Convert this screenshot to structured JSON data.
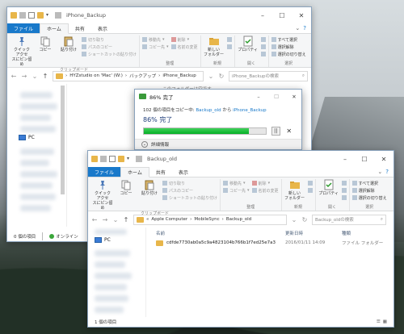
{
  "win1": {
    "title": "iPhone_Backup",
    "tabs": [
      "ファイル",
      "ホーム",
      "共有",
      "表示"
    ],
    "clipboard": {
      "pin": "クイック アクセ\nスにピン留め",
      "copy": "コピー",
      "paste": "貼り付け",
      "cut": "切り取り",
      "copy_path": "パスのコピー",
      "paste_shortcut": "ショートカットの貼り付け",
      "label": "クリップボード"
    },
    "organize": {
      "move": "移動先",
      "copyto": "コピー先",
      "delete": "削除",
      "rename": "名前の変更",
      "label": "整理"
    },
    "new": {
      "folder": "新しい\nフォルダー",
      "label": "新規"
    },
    "open": {
      "props": "プロパティ",
      "label": "開く"
    },
    "select": {
      "all": "すべて選択",
      "none": "選択解除",
      "invert": "選択の切り替え",
      "label": "選択"
    },
    "path": [
      "HYZstudio on 'Mac' (W:)",
      "バックアップ",
      "iPhone_Backup"
    ],
    "search_placeholder": "iPhone_Backupの検索",
    "empty_text": "このフォルダーは空です。",
    "nav_pc": "PC",
    "status": {
      "count": "0 個の項目",
      "online": "オンライン"
    }
  },
  "dialog": {
    "title": "86% 完了",
    "line_prefix": "102 個の項目をコピー中: ",
    "from": "Backup_old",
    "mid": " から ",
    "to": "iPhone_Backup",
    "percent_text": "86% 完了",
    "progress": 0.86,
    "pause_icon": "||",
    "cancel_icon": "✕",
    "details": "詳細情報"
  },
  "win2": {
    "title": "Backup_old",
    "tabs": [
      "ファイル",
      "ホーム",
      "共有",
      "表示"
    ],
    "clipboard": {
      "pin": "クイック アクセ\nスにピン留め",
      "copy": "コピー",
      "paste": "貼り付け",
      "cut": "切り取り",
      "copy_path": "パスのコピー",
      "paste_shortcut": "ショートカットの貼り付け",
      "label": "クリップボード"
    },
    "organize": {
      "move": "移動先",
      "copyto": "コピー先",
      "delete": "削除",
      "rename": "名前の変更",
      "label": "整理"
    },
    "new": {
      "folder": "新しい\nフォルダー",
      "label": "新規"
    },
    "open": {
      "props": "プロパティ",
      "label": "開く"
    },
    "select": {
      "all": "すべて選択",
      "none": "選択解除",
      "invert": "選択の切り替え",
      "label": "選択"
    },
    "path": [
      "Apple Computer",
      "MobileSync",
      "Backup_old"
    ],
    "search_placeholder": "Backup_oldの検索",
    "columns": [
      "名前",
      "更新日時",
      "種類"
    ],
    "rows": [
      {
        "name": "cdfde7730ab0a5c9a4823104b766b1f7ed25e7a3",
        "date": "2016/01/11 14:09",
        "type": "ファイル フォルダー"
      }
    ],
    "nav_pc": "PC",
    "status": {
      "count": "1 個の項目"
    }
  },
  "colors": {
    "file_tab": "#1979ca",
    "progress": "#06b025",
    "link": "#1979ca"
  }
}
